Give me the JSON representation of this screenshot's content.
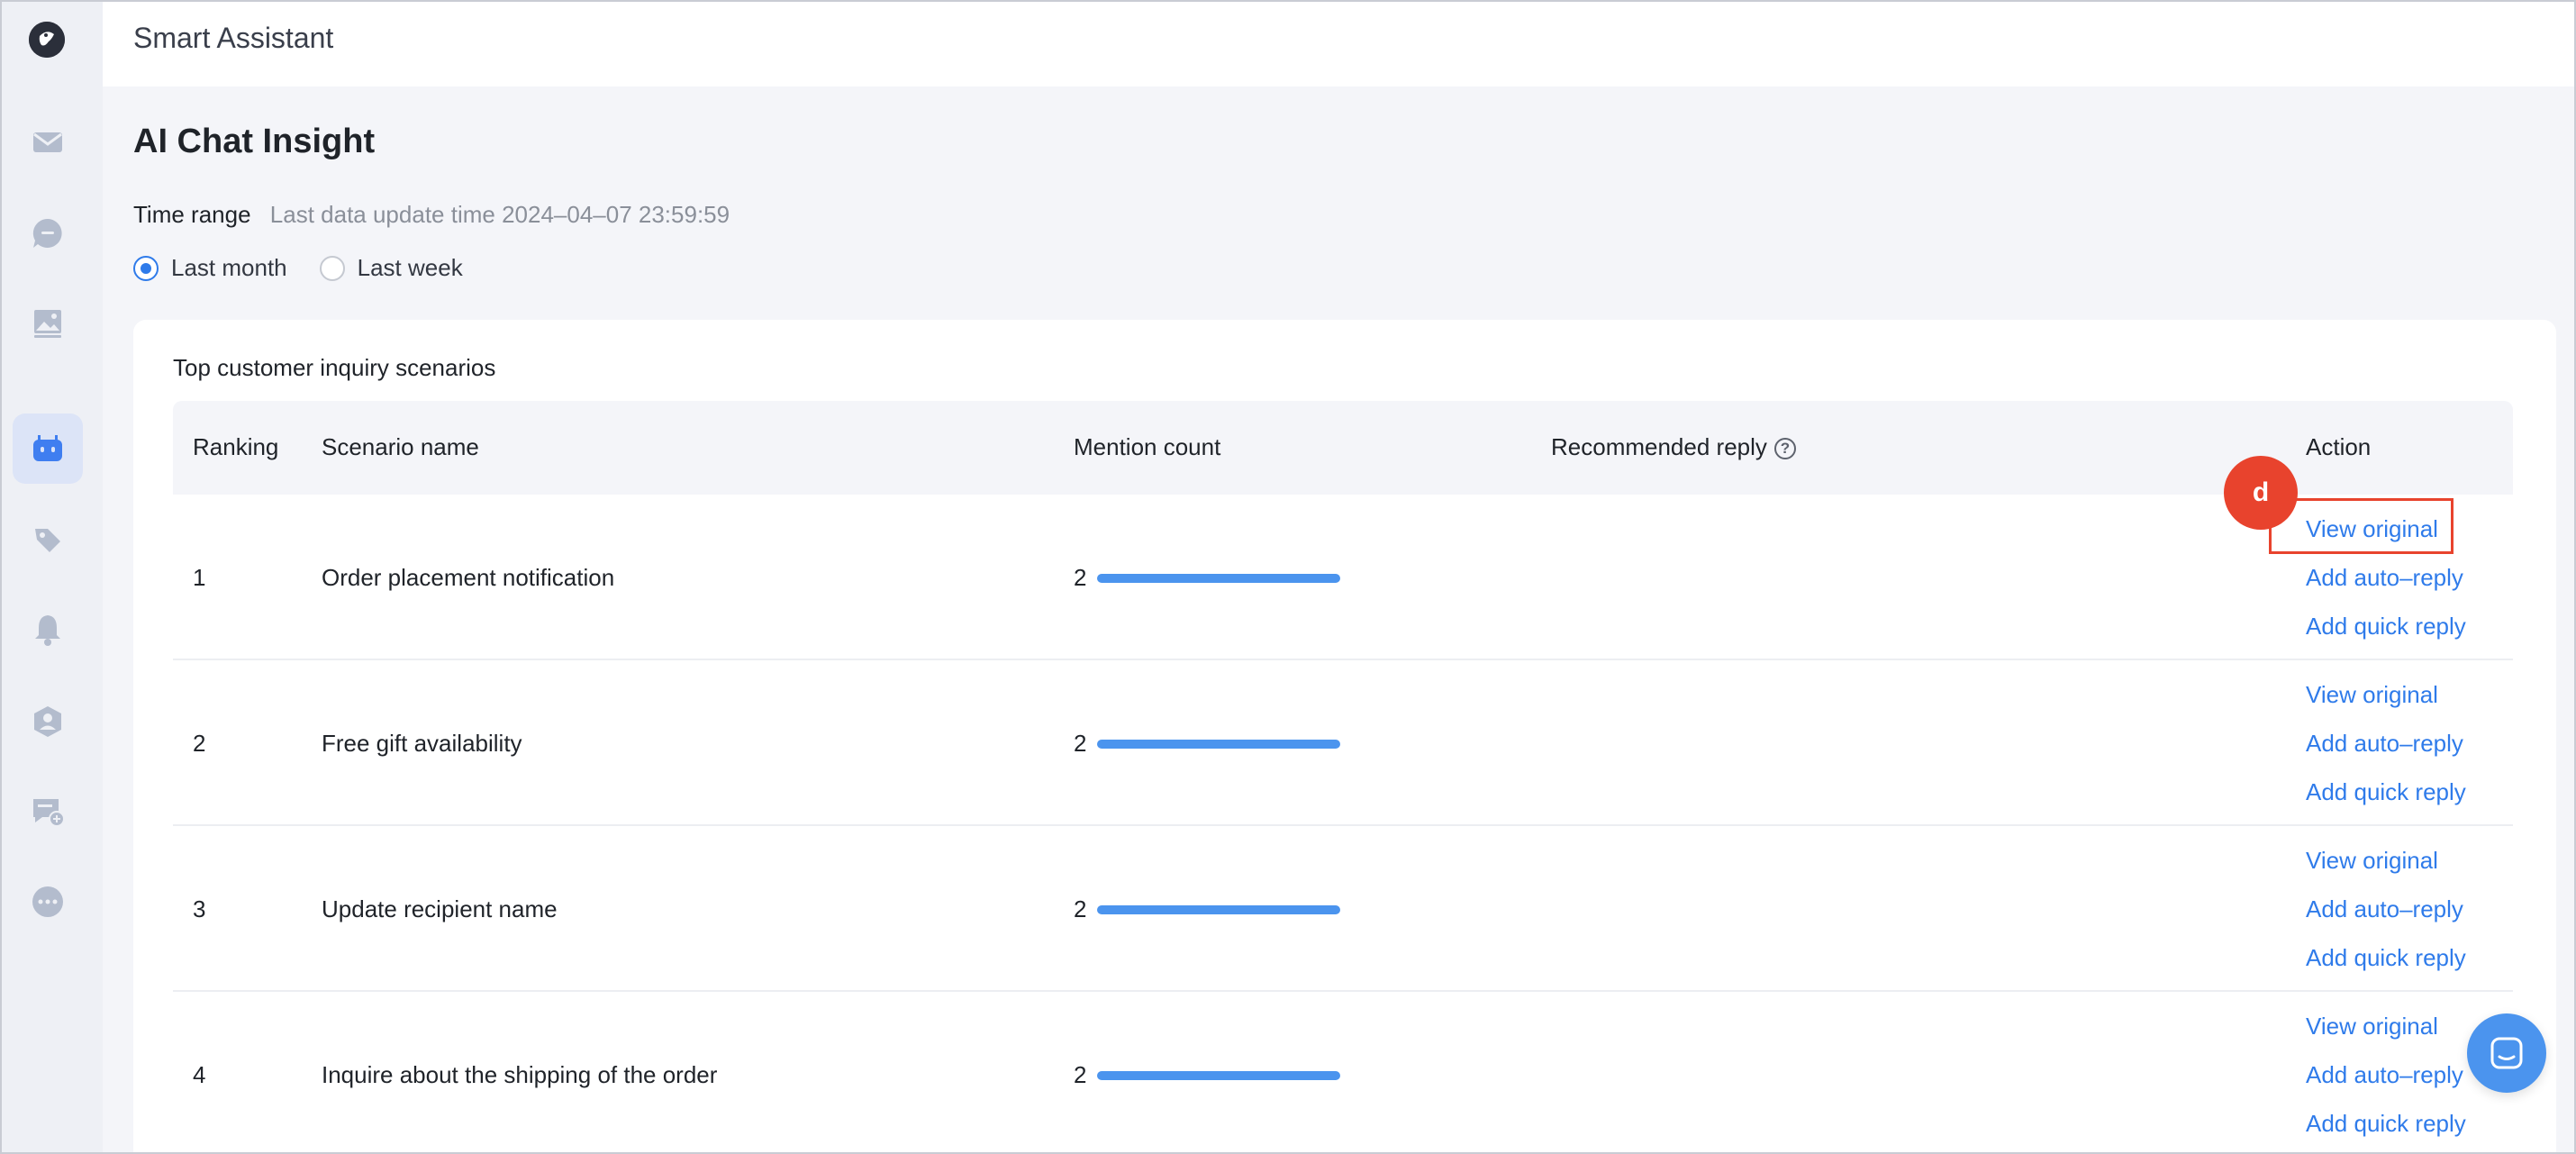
{
  "app": {
    "title": "Smart Assistant"
  },
  "sidebar": {
    "items": [
      {
        "icon": "mail-icon"
      },
      {
        "icon": "chat-bubble-icon"
      },
      {
        "icon": "image-icon"
      },
      {
        "icon": "robot-icon",
        "active": true
      },
      {
        "icon": "tag-icon"
      },
      {
        "icon": "bell-icon"
      },
      {
        "icon": "user-badge-icon"
      },
      {
        "icon": "chat-add-icon"
      },
      {
        "icon": "more-icon"
      }
    ]
  },
  "page": {
    "title": "AI Chat Insight",
    "time_range_label": "Time range",
    "last_update_text": "Last data update time 2024–04–07 23:59:59",
    "radios": [
      {
        "label": "Last month",
        "checked": true
      },
      {
        "label": "Last week",
        "checked": false
      }
    ]
  },
  "card": {
    "title": "Top customer inquiry scenarios",
    "columns": {
      "ranking": "Ranking",
      "scenario": "Scenario name",
      "mention": "Mention count",
      "recommended": "Recommended reply",
      "action": "Action"
    },
    "help_symbol": "?",
    "rows": [
      {
        "rank": "1",
        "name": "Order placement notification",
        "count": "2",
        "actions": [
          "View original",
          "Add auto–reply",
          "Add quick reply"
        ]
      },
      {
        "rank": "2",
        "name": "Free gift availability",
        "count": "2",
        "actions": [
          "View original",
          "Add auto–reply",
          "Add quick reply"
        ]
      },
      {
        "rank": "3",
        "name": "Update recipient name",
        "count": "2",
        "actions": [
          "View original",
          "Add auto–reply",
          "Add quick reply"
        ]
      },
      {
        "rank": "4",
        "name": "Inquire about the shipping of the order",
        "count": "2",
        "actions": [
          "View original",
          "Add auto–reply",
          "Add quick reply"
        ]
      }
    ]
  },
  "annotation": {
    "marker_label": "d",
    "color": "#e8432d"
  },
  "colors": {
    "accent": "#2f7bea",
    "bar": "#4b94ee"
  }
}
